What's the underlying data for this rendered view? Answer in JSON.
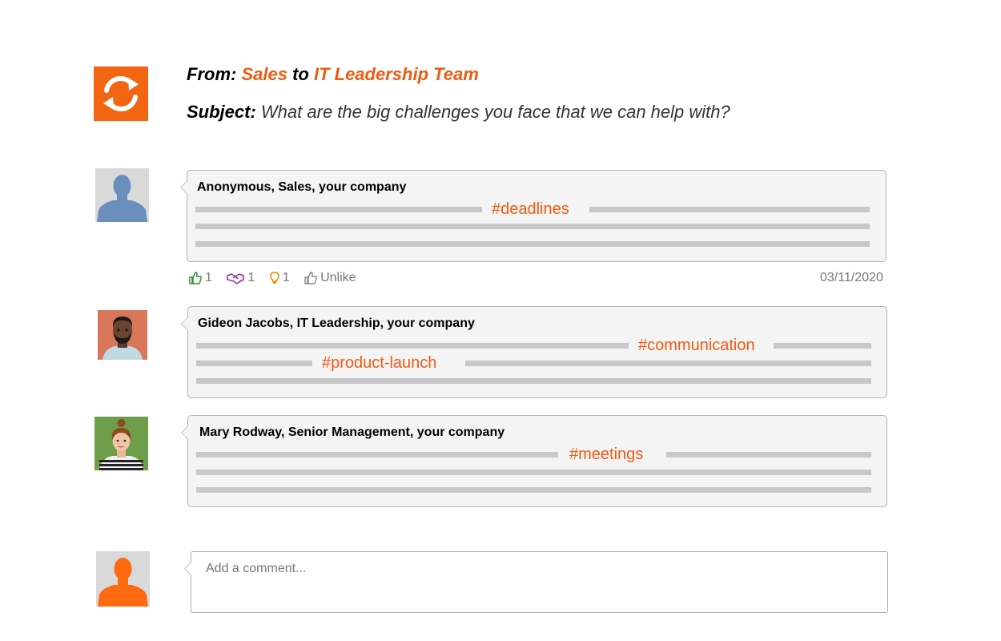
{
  "header": {
    "from_label": "From:",
    "from_group": "Sales",
    "to_word": "to",
    "to_group": "IT Leadership Team",
    "subject_label": "Subject:",
    "subject_text": "What are the big challenges you face that we can help with?"
  },
  "icons": {
    "logo": "refresh-arrows-icon",
    "like": "thumbs-up-icon",
    "agree": "handshake-icon",
    "idea": "lightbulb-icon",
    "unlike": "thumbs-up-outline-icon"
  },
  "colors": {
    "accent": "#f05a12",
    "like": "#2e8b2e",
    "agree": "#9b2d9b",
    "idea": "#f08a00"
  },
  "comments": [
    {
      "author": "Anonymous, Sales, your company",
      "tags": [
        "#deadlines"
      ],
      "reactions": {
        "likes": "1",
        "agrees": "1",
        "ideas": "1",
        "unlike_label": "Unlike"
      },
      "date": "03/11/2020"
    },
    {
      "author": "Gideon Jacobs, IT Leadership, your company",
      "tags": [
        "#communication",
        "#product-launch"
      ]
    },
    {
      "author": "Mary Rodway, Senior Management, your company",
      "tags": [
        "#meetings"
      ]
    }
  ],
  "comment_input": {
    "placeholder": "Add a comment..."
  }
}
